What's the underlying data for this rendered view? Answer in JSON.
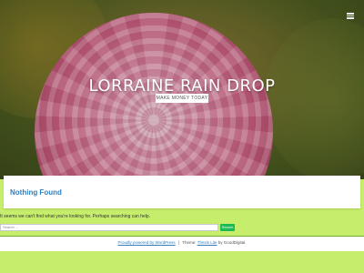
{
  "header": {
    "site_title": "LORRAINE RAIN DROP",
    "tagline": "MAKE MONEY TODAY",
    "menu_icon": "hamburger-menu-icon"
  },
  "main": {
    "heading": "Nothing Found",
    "notice": "It seems we can't find what you're looking for. Perhaps searching can help.",
    "search": {
      "placeholder": "Search ...",
      "button_label": "Search"
    }
  },
  "footer": {
    "powered_by": "Proudly powered by WordPress",
    "separator": "|",
    "theme_prefix": "Theme:",
    "theme_name": "Thesis Lite",
    "by_text": "by GoodDigital."
  },
  "colors": {
    "page_bg": "#c6ee6c",
    "link": "#2f7fc2",
    "button": "#1db954"
  }
}
